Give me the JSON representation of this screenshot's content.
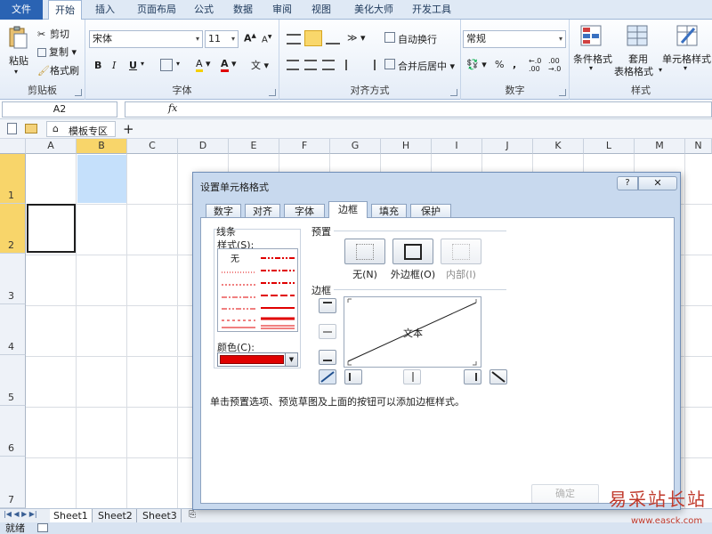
{
  "ribbon_tabs": [
    "文件",
    "开始",
    "插入",
    "页面布局",
    "公式",
    "数据",
    "审阅",
    "视图",
    "美化大师",
    "开发工具"
  ],
  "clipboard": {
    "paste": "粘贴",
    "cut": "剪切",
    "copy": "复制",
    "format_painter": "格式刷",
    "label": "剪贴板"
  },
  "font": {
    "name": "宋体",
    "size": "11",
    "label": "字体",
    "bold": "B",
    "italic": "I",
    "underline": "U",
    "grow": "A",
    "shrink": "A",
    "font_color_letter": "A",
    "highlight_letter": "A"
  },
  "alignment": {
    "wrap": "自动换行",
    "merge": "合并后居中",
    "label": "对齐方式"
  },
  "number": {
    "format": "常规",
    "percent": "%",
    "comma": ",",
    "label": "数字"
  },
  "styles": {
    "conditional": "条件格式",
    "table": "套用",
    "table2": "表格格式",
    "cell": "单元格样式",
    "label": "样式"
  },
  "formula_bar": {
    "name_box": "A2",
    "fx": "fx"
  },
  "doc_tabs": {
    "template": "模板专区",
    "add": "+"
  },
  "columns": [
    "A",
    "B",
    "C",
    "D",
    "E",
    "F",
    "G",
    "H",
    "I",
    "J",
    "K",
    "L",
    "M",
    "N"
  ],
  "rows": [
    "1",
    "2",
    "3",
    "4",
    "5",
    "6",
    "7"
  ],
  "sheets": [
    "Sheet1",
    "Sheet2",
    "Sheet3"
  ],
  "status": "就绪",
  "dialog": {
    "title": "设置单元格格式",
    "help": "?",
    "close": "✕",
    "tabs": [
      "数字",
      "对齐",
      "字体",
      "边框",
      "填充",
      "保护"
    ],
    "lines_label": "线条",
    "style_label": "样式(S):",
    "none_style": "无",
    "color_label": "颜色(C):",
    "presets_label": "预置",
    "preset_none": "无(N)",
    "preset_outline": "外边框(O)",
    "preset_inside": "内部(I)",
    "border_label": "边框",
    "preview_text": "文本",
    "hint": "单击预置选项、预览草图及上面的按钮可以添加边框样式。",
    "ok": "确定"
  },
  "watermark": {
    "text": "易采站长站",
    "url": "www.easck.com"
  },
  "colors": {
    "accent": "#2a63b3",
    "selected_header": "#f8d56a",
    "line_color": "#e00000",
    "cell_fill": "#c5e0fb"
  }
}
